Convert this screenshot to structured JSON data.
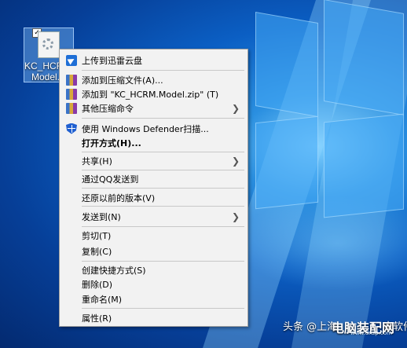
{
  "desktop": {
    "file": {
      "label_line1": "KC_HCRM.",
      "label_line2": "Model.c",
      "checkbox": "✓",
      "icon": "config-file-icon"
    }
  },
  "context_menu": {
    "items": [
      {
        "label": "上传到迅雷云盘",
        "icon": "cloud-upload-icon"
      },
      {
        "label": "添加到压缩文件(A)...",
        "icon": "archive-icon"
      },
      {
        "label": "添加到 \"KC_HCRM.Model.zip\" (T)",
        "icon": "archive-icon"
      },
      {
        "label": "其他压缩命令",
        "icon": "archive-icon",
        "arrow": "❯"
      },
      {
        "label": "使用 Windows Defender扫描...",
        "icon": "defender-shield-icon"
      },
      {
        "label": "打开方式(H)..."
      },
      {
        "label": "共享(H)",
        "arrow": "❯"
      },
      {
        "label": "通过QQ发送到"
      },
      {
        "label": "还原以前的版本(V)"
      },
      {
        "label": "发送到(N)",
        "arrow": "❯"
      },
      {
        "label": "剪切(T)"
      },
      {
        "label": "复制(C)"
      },
      {
        "label": "创建快捷方式(S)"
      },
      {
        "label": "删除(D)"
      },
      {
        "label": "重命名(M)"
      },
      {
        "label": "属性(R)"
      }
    ]
  },
  "watermark": {
    "prefix": "头条 @上海",
    "big": "电脑装配网",
    "small": "www.dnzp.com",
    "suffix": "康软件"
  }
}
